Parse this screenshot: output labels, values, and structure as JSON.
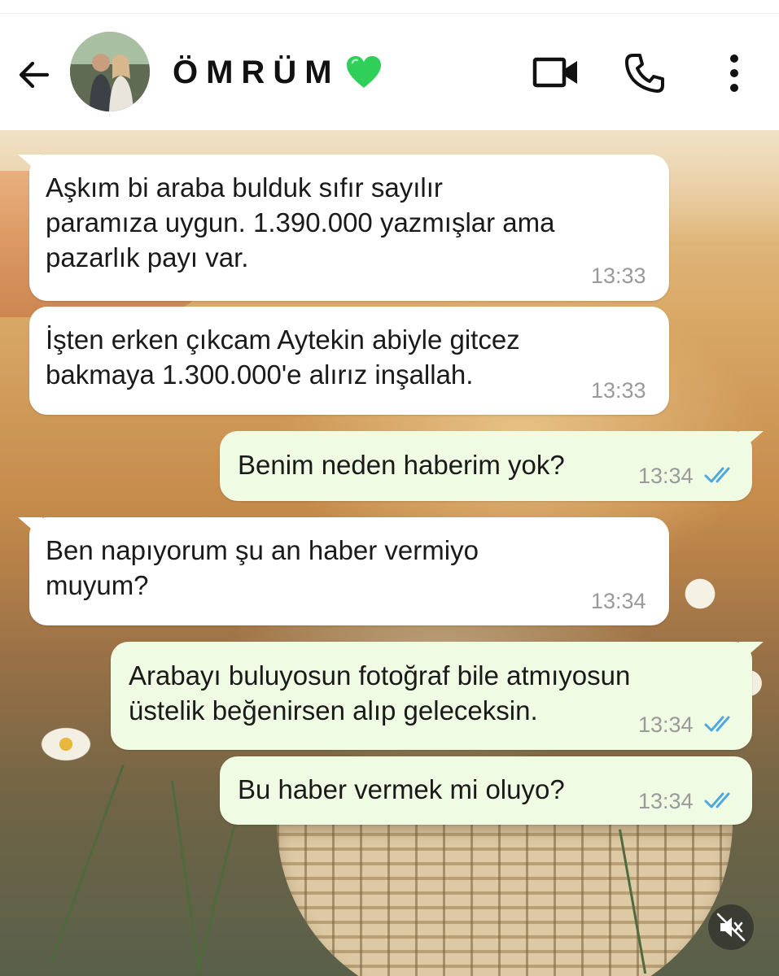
{
  "contact": {
    "name": "ÖMRÜM",
    "name_emoji": "green-heart"
  },
  "header": {
    "icons": [
      "back-arrow-icon",
      "video-call-icon",
      "phone-call-icon",
      "more-options-icon"
    ]
  },
  "messages": [
    {
      "direction": "incoming",
      "text": "Aşkım bi araba bulduk sıfır sayılır\nparamıza uygun. 1.390.000 yazmışlar ama\npazarlık payı var.",
      "time": "13:33"
    },
    {
      "direction": "incoming",
      "text": "İşten erken çıkcam Aytekin abiyle gitcez\nbakmaya 1.300.000'e alırız inşallah.",
      "time": "13:33"
    },
    {
      "direction": "outgoing",
      "text": "Benim neden haberim yok?",
      "time": "13:34",
      "status": "read"
    },
    {
      "direction": "incoming",
      "text": "Ben napıyorum şu an haber vermiyo\nmuyum?",
      "time": "13:34"
    },
    {
      "direction": "outgoing",
      "text": "Arabayı buluyosun fotoğraf bile atmıyosun\nüstelik beğenirsen alıp geleceksin.",
      "time": "13:34",
      "status": "read"
    },
    {
      "direction": "outgoing",
      "text": "Bu haber vermek mi oluyo?",
      "time": "13:34",
      "status": "read"
    }
  ],
  "colors": {
    "incoming_bubble": "#ffffff",
    "outgoing_bubble": "#effbe3",
    "read_ticks": "#4fa9e0",
    "time_text": "#9a9a9a",
    "heart": "#2fcf5a"
  },
  "overlay": {
    "icon": "muted-speaker-icon"
  }
}
